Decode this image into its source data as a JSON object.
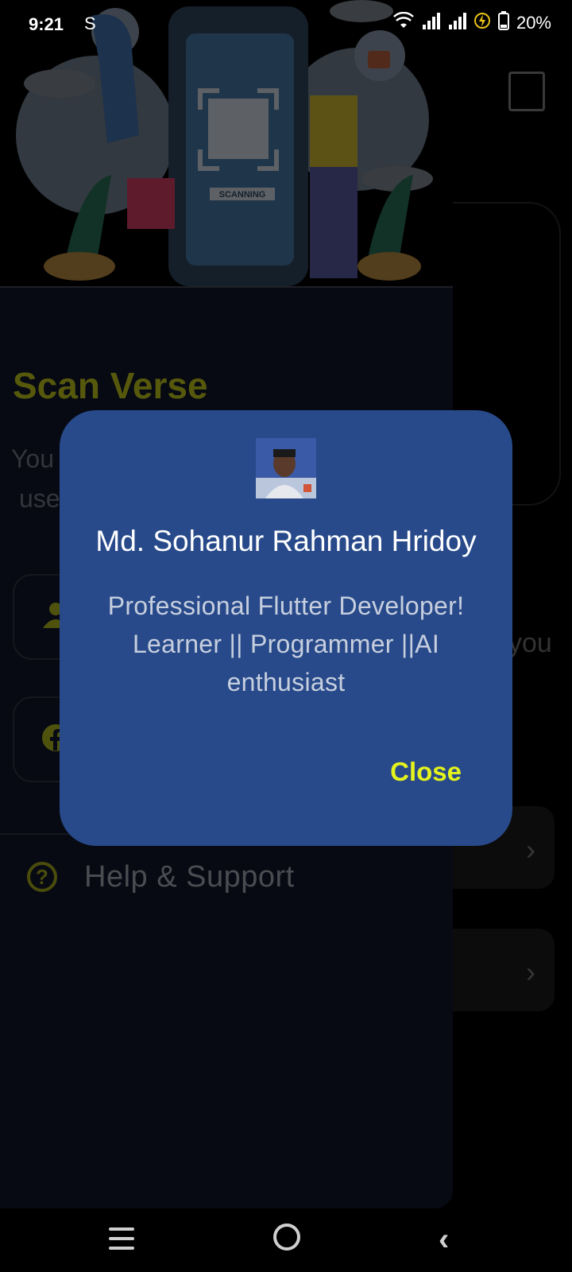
{
  "status_bar": {
    "time": "9:21",
    "carrier_icon": "S",
    "battery": "20%"
  },
  "drawer": {
    "illustration_label": "SCANNING",
    "title": "Scan Verse",
    "desc_line1": "You",
    "desc_line2": "use",
    "help_label": "Help & Support"
  },
  "background": {
    "partial_text": "you"
  },
  "dialog": {
    "name": "Md. Sohanur Rahman Hridoy",
    "bio": "Professional Flutter Developer! Learner || Programmer ||AI enthusiast",
    "close_label": "Close"
  },
  "colors": {
    "dialog_bg": "#284a8a",
    "accent": "#e4f21d",
    "drawer_title": "#7f8312"
  }
}
